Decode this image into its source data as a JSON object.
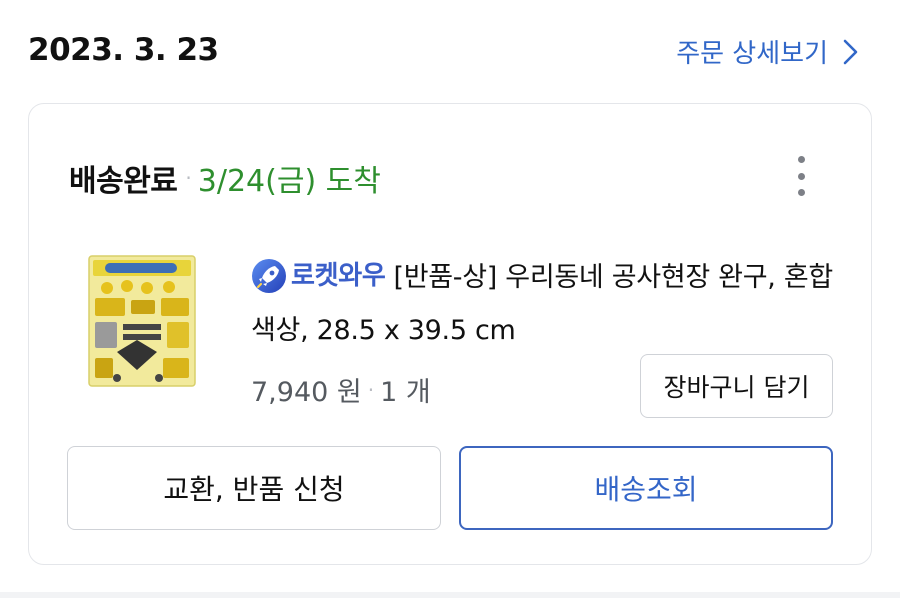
{
  "order": {
    "date": "2023. 3. 23",
    "detail_link_label": "주문 상세보기"
  },
  "shipment": {
    "status": "배송완료",
    "separator": "·",
    "arrival": "3/24(금) 도착",
    "more_icon": "more-vertical-icon"
  },
  "product": {
    "badge_label": "로켓와우",
    "badge_icon": "rocket-icon",
    "title": "[반품-상] 우리동네 공사현장 완구, 혼합색상, 28.5 x 39.5 cm",
    "price": "7,940 원",
    "price_separator": "·",
    "quantity": "1 개",
    "thumbnail": "product-image"
  },
  "actions": {
    "cart_label": "장바구니 담기",
    "exchange_label": "교환, 반품 신청",
    "tracking_label": "배송조회"
  },
  "colors": {
    "accent_blue": "#3167c8",
    "arrival_green": "#2e8f2e",
    "badge_blue": "#3b5fc9"
  }
}
